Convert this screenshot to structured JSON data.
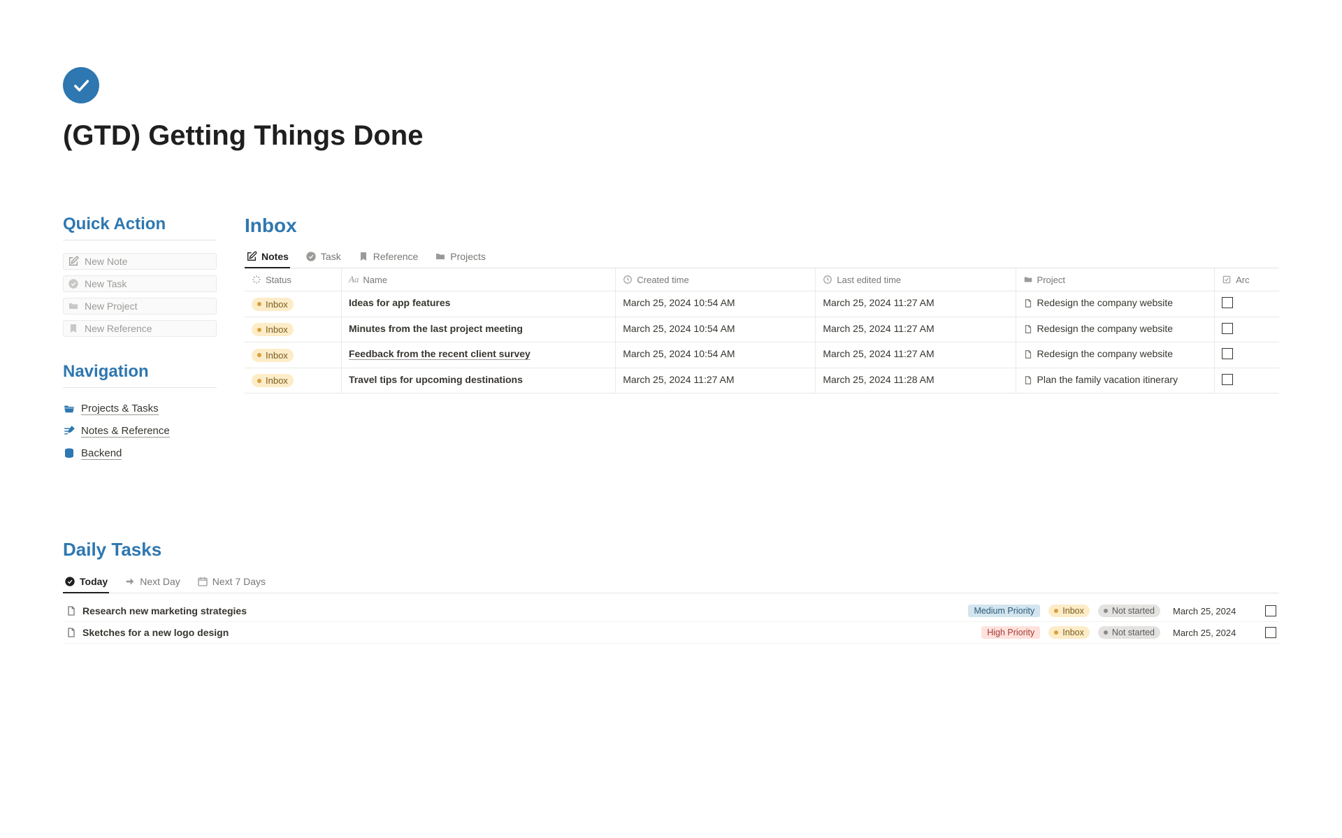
{
  "page": {
    "title": "(GTD) Getting Things Done"
  },
  "quick_action": {
    "heading": "Quick Action",
    "items": [
      "New Note",
      "New Task",
      "New Project",
      "New Reference"
    ]
  },
  "navigation": {
    "heading": "Navigation",
    "items": [
      "Projects & Tasks",
      "Notes & Reference",
      "Backend"
    ]
  },
  "inbox": {
    "heading": "Inbox",
    "tabs": [
      "Notes",
      "Task",
      "Reference",
      "Projects"
    ],
    "active_tab": 0,
    "columns": {
      "status": "Status",
      "name": "Name",
      "created": "Created time",
      "edited": "Last edited time",
      "project": "Project",
      "arc": "Arc"
    },
    "rows": [
      {
        "status": "Inbox",
        "name": "Ideas for app features",
        "created": "March 25, 2024 10:54 AM",
        "edited": "March 25, 2024 11:27 AM",
        "project": "Redesign the company website"
      },
      {
        "status": "Inbox",
        "name": "Minutes from the last project meeting",
        "created": "March 25, 2024 10:54 AM",
        "edited": "March 25, 2024 11:27 AM",
        "project": "Redesign the company website"
      },
      {
        "status": "Inbox",
        "name": "Feedback from the recent client survey",
        "created": "March 25, 2024 10:54 AM",
        "edited": "March 25, 2024 11:27 AM",
        "project": "Redesign the company website"
      },
      {
        "status": "Inbox",
        "name": "Travel tips for upcoming destinations",
        "created": "March 25, 2024 11:27 AM",
        "edited": "March 25, 2024 11:28 AM",
        "project": "Plan the family vacation itinerary"
      }
    ]
  },
  "daily": {
    "heading": "Daily Tasks",
    "tabs": [
      "Today",
      "Next Day",
      "Next 7 Days"
    ],
    "active_tab": 0,
    "tasks": [
      {
        "title": "Research new marketing strategies",
        "priority": "Medium Priority",
        "priority_class": "medium",
        "status1": "Inbox",
        "status2": "Not started",
        "date": "March 25, 2024"
      },
      {
        "title": "Sketches for a new logo design",
        "priority": "High Priority",
        "priority_class": "high",
        "status1": "Inbox",
        "status2": "Not started",
        "date": "March 25, 2024"
      }
    ]
  }
}
